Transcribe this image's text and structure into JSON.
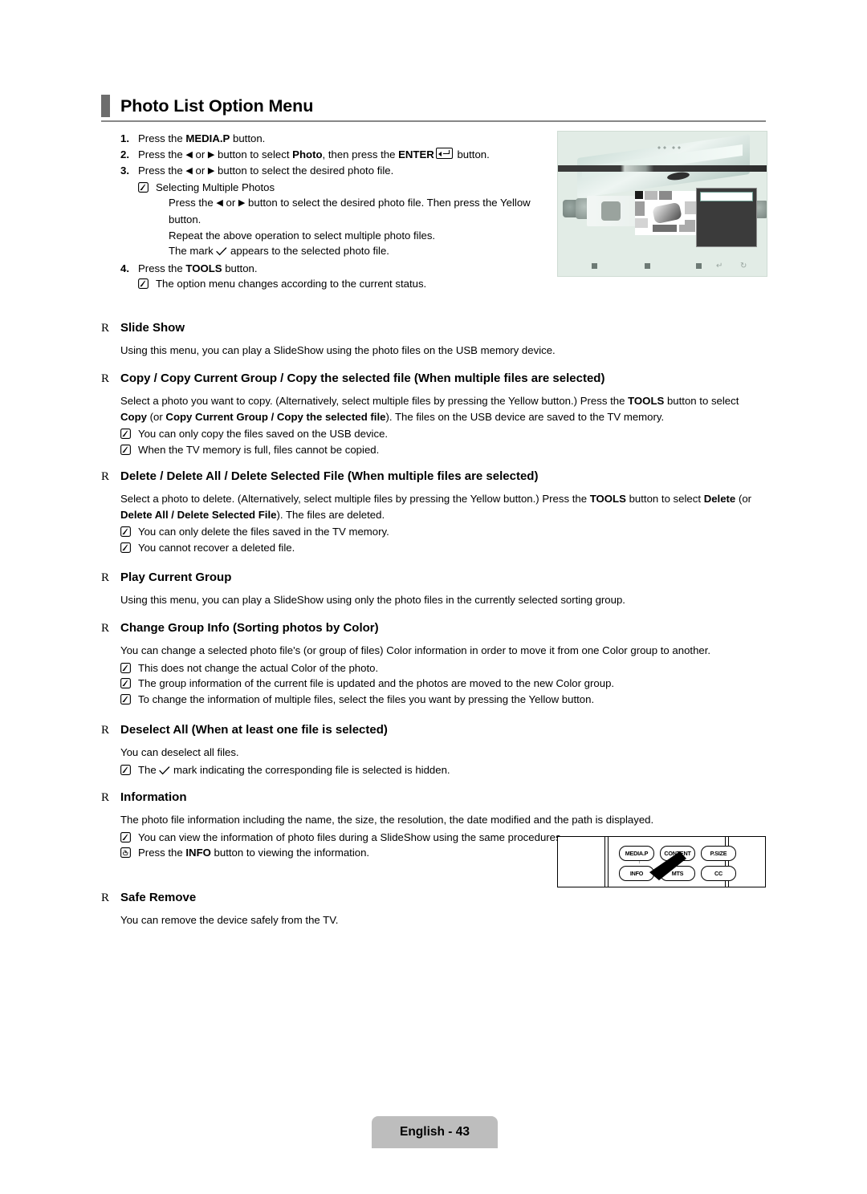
{
  "page": {
    "title": "Photo List Option Menu",
    "footer_label": "English - 43"
  },
  "steps": [
    {
      "num": "1.",
      "parts": [
        {
          "t": "Press the ",
          "b": false
        },
        {
          "t": "MEDIA.P",
          "b": true
        },
        {
          "t": " button.",
          "b": false
        }
      ]
    },
    {
      "num": "2.",
      "parts": [
        {
          "t": "Press the ",
          "b": false
        },
        {
          "t": "◀",
          "b": false
        },
        {
          "t": " or ",
          "b": false
        },
        {
          "t": "▶",
          "b": false
        },
        {
          "t": " button to select ",
          "b": false
        },
        {
          "t": "Photo",
          "b": true
        },
        {
          "t": ", then press the ",
          "b": false
        },
        {
          "t": "ENTER",
          "b": true
        },
        {
          "t": "__ENTER_GLYPH__",
          "b": false
        },
        {
          "t": " button.",
          "b": false
        }
      ]
    },
    {
      "num": "3.",
      "parts": [
        {
          "t": "Press the ",
          "b": false
        },
        {
          "t": "◀",
          "b": false
        },
        {
          "t": " or ",
          "b": false
        },
        {
          "t": "▶",
          "b": false
        },
        {
          "t": " button to select the desired photo file.",
          "b": false
        }
      ]
    }
  ],
  "step3_note": "Selecting Multiple Photos",
  "step3_sub": [
    "Press the ◀ or ▶ button to select the desired photo file. Then press the Yellow button.",
    "Repeat the above operation to select multiple photo files.",
    "The mark ✓ appears to the selected photo file."
  ],
  "step4": {
    "num": "4.",
    "prefix": "Press the ",
    "bold": "TOOLS",
    "suffix": " button."
  },
  "step4_note": "The option menu changes according to the current status.",
  "sections": [
    {
      "bullet": "R",
      "heading": "Slide Show",
      "body": "Using this menu, you can play a SlideShow using the photo files on the USB memory device.",
      "notes": []
    },
    {
      "bullet": "R",
      "heading": "Copy / Copy Current Group / Copy the selected file (When multiple files are selected)",
      "body": "Select a photo you want to copy. (Alternatively, select multiple files by pressing the Yellow button.) Press the TOOLS button to select Copy (or Copy Current Group / Copy the selected file). The files on the USB device are saved to the TV memory.",
      "notes": [
        "You can only copy the files saved on the USB device.",
        "When the TV memory is full, files cannot be copied."
      ]
    },
    {
      "bullet": "R",
      "heading": "Delete / Delete All / Delete Selected File (When multiple files are selected)",
      "body": "Select a photo to delete. (Alternatively, select multiple files by pressing the Yellow button.) Press the TOOLS button to select Delete (or Delete All / Delete Selected File). The files are deleted.",
      "notes": [
        "You can only delete the files saved in the TV memory.",
        "You cannot recover a deleted file."
      ]
    },
    {
      "bullet": "R",
      "heading": "Play Current Group",
      "body": "Using this menu, you can play a SlideShow using only the photo files in the currently selected sorting group.",
      "notes": []
    },
    {
      "bullet": "R",
      "heading": "Change Group Info (Sorting photos by Color)",
      "body": "You can change a selected photo file's (or group of files) Color information in order to move it from one Color group to another.",
      "notes": [
        "This does not change the actual Color of the photo.",
        "The group information of the current file is updated and the photos are moved to the new Color group.",
        "To change the information of multiple files, select the files you want by pressing the Yellow button."
      ]
    },
    {
      "bullet": "R",
      "heading": "Deselect All (When at least one file is selected)",
      "body": "You can deselect all files.",
      "notes": [
        "The ✓ mark indicating the corresponding file is selected is hidden."
      ]
    },
    {
      "bullet": "R",
      "heading": "Information",
      "body": "The photo file information including the name, the size, the resolution, the date modified and the path is displayed.",
      "notes": [
        "You can view the information of photo files during a SlideShow using the same procedures.",
        "Press the INFO button to viewing the information."
      ]
    },
    {
      "bullet": "R",
      "heading": "Safe Remove",
      "body": "You can remove the device safely from the TV.",
      "notes": []
    }
  ],
  "remote": {
    "buttons": [
      "MEDIA.P",
      "CONTENT",
      "P.SIZE",
      "INFO",
      "MTS",
      "CC"
    ]
  },
  "colors": {
    "title_bar": "#6d6d6d",
    "rule": "#878787",
    "tab_bg": "#bdbdbd",
    "tv_bg": "#e2ece6"
  }
}
